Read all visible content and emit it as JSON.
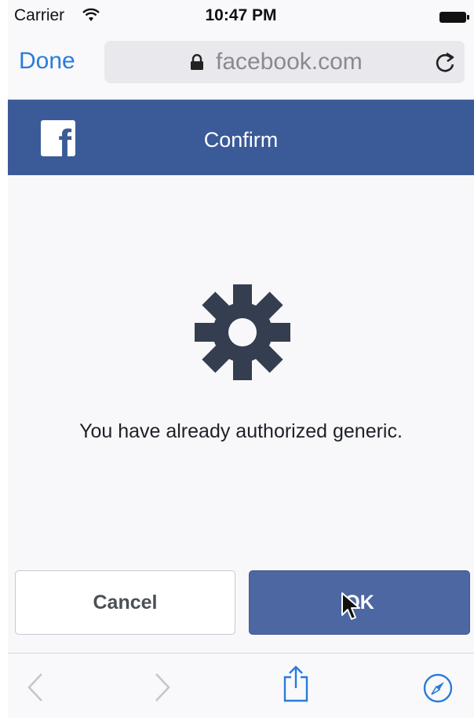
{
  "status_bar": {
    "carrier": "Carrier",
    "time": "10:47 PM"
  },
  "browser": {
    "done_label": "Done",
    "url": "facebook.com"
  },
  "header": {
    "logo_letter": "f",
    "title": "Confirm"
  },
  "dialog": {
    "message": "You have already authorized generic.",
    "cancel_label": "Cancel",
    "ok_label": "OK"
  },
  "icons": {
    "wifi": "wifi-icon",
    "battery": "battery-icon",
    "lock": "lock-icon",
    "reload": "reload-icon",
    "gear": "gear-icon",
    "back": "chevron-left-icon",
    "forward": "chevron-right-icon",
    "share": "share-icon",
    "compass": "compass-icon",
    "cursor": "mouse-cursor-icon"
  },
  "colors": {
    "facebook_blue": "#3b5a98",
    "ok_button": "#4c67a1",
    "link_blue": "#2a7bdc",
    "gear": "#343e50"
  }
}
